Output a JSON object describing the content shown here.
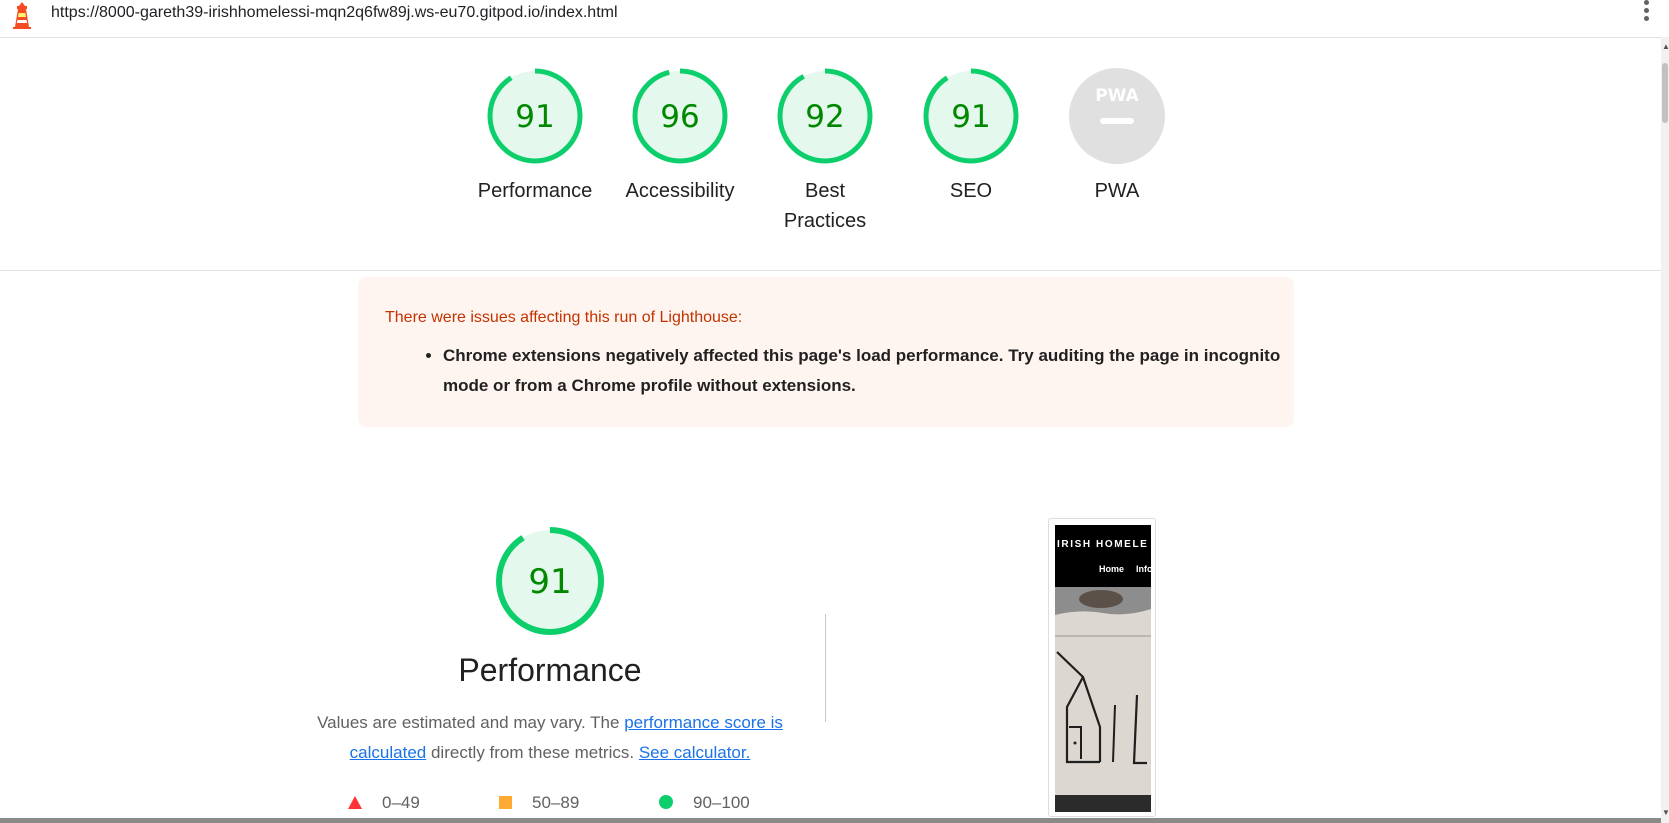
{
  "address_bar": {
    "url": "https://8000-gareth39-irishhomelessi-mqn2q6fw89j.ws-eu70.gitpod.io/index.html"
  },
  "icons": {
    "lighthouse": "lighthouse-icon",
    "menu": "kebab-menu-icon",
    "fail": "red-triangle-icon",
    "average": "orange-square-icon",
    "pass": "green-circle-icon"
  },
  "colors": {
    "pass_green": "#0cce6b",
    "pass_text": "#008800",
    "pass_fill": "#e5f8ed",
    "average": "#ffaa33",
    "fail": "#ff3333",
    "warning_bg": "#fff5f0",
    "warning_text": "#c33300",
    "link": "#1a73e8"
  },
  "gauges": [
    {
      "score": "91",
      "label": "Performance"
    },
    {
      "score": "96",
      "label": "Accessibility"
    },
    {
      "score": "92",
      "label_line1": "Best",
      "label_line2": "Practices"
    },
    {
      "score": "91",
      "label": "SEO"
    },
    {
      "badge": "PWA",
      "label": "PWA"
    }
  ],
  "warning": {
    "title": "There were issues affecting this run of Lighthouse:",
    "items": [
      "Chrome extensions negatively affected this page's load performance. Try auditing the page in incognito mode or from a Chrome profile without extensions."
    ]
  },
  "performance": {
    "score": "91",
    "title": "Performance",
    "desc_prefix": "Values are estimated and may vary. The",
    "link_score": "performance score is calculated",
    "desc_middle": "directly from these metrics.",
    "link_calc": "See calculator."
  },
  "legend": [
    {
      "range": "0–49"
    },
    {
      "range": "50–89"
    },
    {
      "range": "90–100"
    }
  ],
  "screenshot": {
    "brand": "IRISH HOMELE",
    "nav_home": "Home",
    "nav_info": "Info"
  }
}
